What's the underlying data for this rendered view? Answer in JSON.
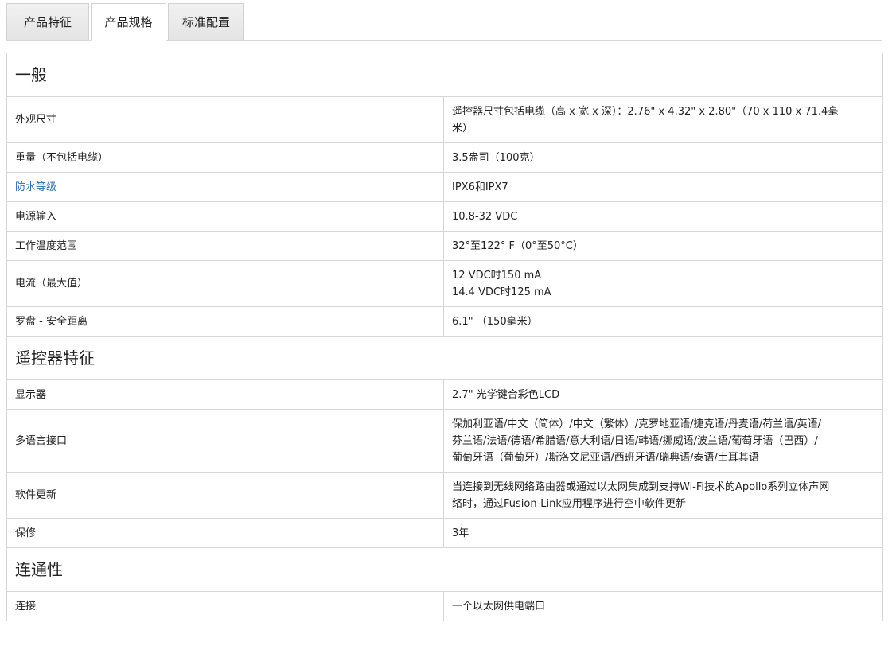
{
  "tabs": [
    {
      "label": "产品特征",
      "active": false
    },
    {
      "label": "产品规格",
      "active": true
    },
    {
      "label": "标准配置",
      "active": false
    }
  ],
  "sections": [
    {
      "title": "一般",
      "rows": [
        {
          "label": "外观尺寸",
          "value": [
            "遥控器尺寸包括电缆（高 x 宽 x 深）：2.76\" x 4.32\" x 2.80\"（70 x 110 x 71.4毫",
            "米）"
          ]
        },
        {
          "label": "重量（不包括电缆）",
          "value": [
            "3.5盎司（100克）"
          ]
        },
        {
          "label": "防水等级",
          "value": [
            "IPX6和IPX7"
          ],
          "label_is_link": true
        },
        {
          "label": "电源输入",
          "value": [
            "10.8-32 VDC"
          ]
        },
        {
          "label": "工作温度范围",
          "value": [
            "32°至122° F（0°至50°C）"
          ]
        },
        {
          "label": "电流（最大值）",
          "value": [
            "12 VDC时150 mA",
            "14.4 VDC时125 mA"
          ]
        },
        {
          "label": "罗盘 - 安全距离",
          "value": [
            "6.1\" （150毫米）"
          ]
        }
      ]
    },
    {
      "title": "遥控器特征",
      "rows": [
        {
          "label": "显示器",
          "value": [
            "2.7\" 光学键合彩色LCD"
          ]
        },
        {
          "label": "多语言接口",
          "value": [
            "保加利亚语/中文（简体）/中文（繁体）/克罗地亚语/捷克语/丹麦语/荷兰语/英语/",
            "芬兰语/法语/德语/希腊语/意大利语/日语/韩语/挪威语/波兰语/葡萄牙语（巴西）/",
            "葡萄牙语（葡萄牙）/斯洛文尼亚语/西班牙语/瑞典语/泰语/土耳其语"
          ]
        },
        {
          "label": "软件更新",
          "value": [
            "当连接到无线网络路由器或通过以太网集成到支持Wi-Fi技术的Apollo系列立体声网",
            "络时，通过Fusion-Link应用程序进行空中软件更新"
          ]
        },
        {
          "label": "保修",
          "value": [
            "3年"
          ]
        }
      ]
    },
    {
      "title": "连通性",
      "rows": [
        {
          "label": "连接",
          "value": [
            "一个以太网供电端口"
          ]
        }
      ]
    }
  ]
}
